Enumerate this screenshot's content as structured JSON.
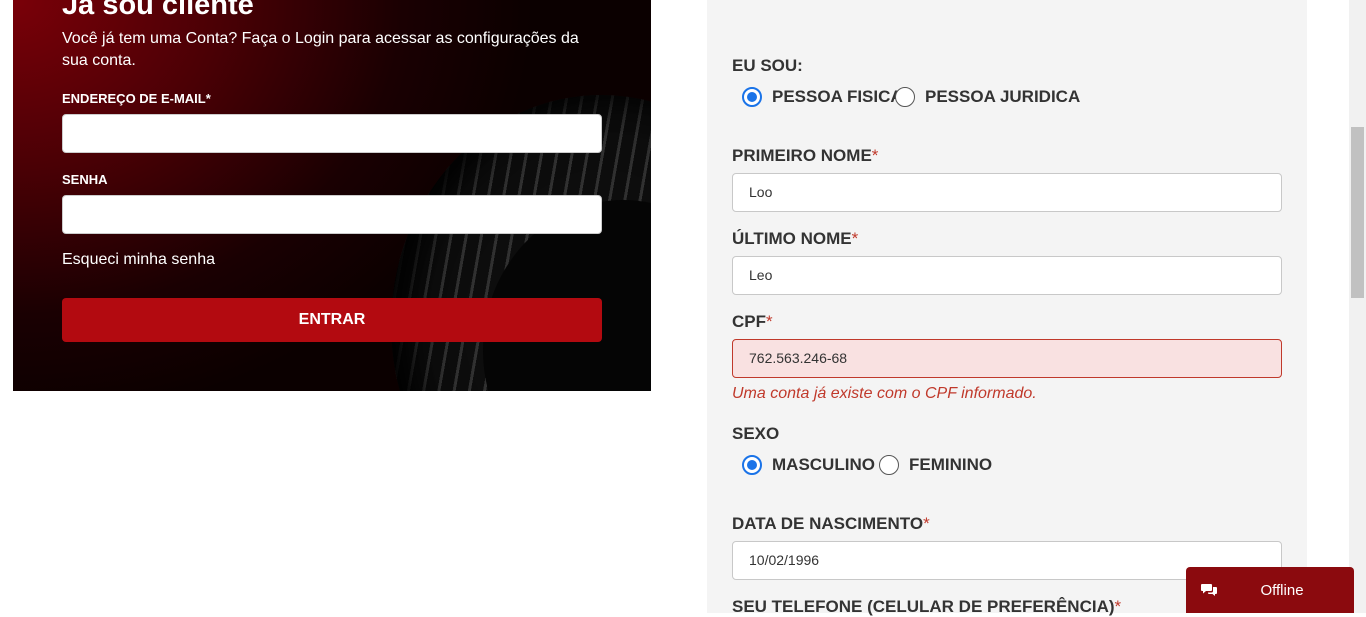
{
  "login": {
    "title": "Já sou cliente",
    "description": "Você já tem uma Conta? Faça o Login para acessar as configurações da sua conta.",
    "email_label": "ENDEREÇO DE E-MAIL*",
    "email_value": "",
    "password_label": "SENHA",
    "password_value": "",
    "forgot_link": "Esqueci minha senha",
    "submit_label": "ENTRAR"
  },
  "register": {
    "person_type_label": "EU SOU:",
    "person_type_options": [
      "PESSOA FISICA",
      "PESSOA JURIDICA"
    ],
    "person_type_selected": "PESSOA FISICA",
    "first_name_label": "PRIMEIRO NOME",
    "first_name_value": "Loo",
    "last_name_label": "ÚLTIMO NOME",
    "last_name_value": "Leo",
    "cpf_label": "CPF",
    "cpf_value": "762.563.246-68",
    "cpf_error": "Uma conta já existe com o CPF informado.",
    "gender_label": "SEXO",
    "gender_options": [
      "MASCULINO",
      "FEMININO"
    ],
    "gender_selected": "MASCULINO",
    "birthdate_label": "DATA DE NASCIMENTO",
    "birthdate_value": "10/02/1996",
    "phone_label": "SEU TELEFONE (CELULAR DE PREFERÊNCIA)",
    "required_mark": "*"
  },
  "chat": {
    "status": "Offline",
    "icon": "chat-bubbles-icon"
  },
  "colors": {
    "brand_red": "#b30a10",
    "chat_red": "#8b0a0e",
    "error_red": "#c0392b",
    "radio_blue": "#1a73e8"
  }
}
